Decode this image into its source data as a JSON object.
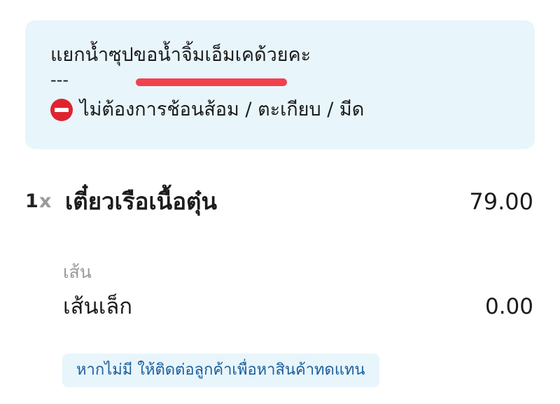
{
  "note": {
    "customer_note": "แยกน้ำซุปขอน้ำจิ้มเอ็มเคด้วยคะ",
    "separator": "---",
    "cutlery_icon": "no-entry-icon",
    "cutlery_text": "ไม่ต้องการช้อนส้อม / ตะเกียบ / มีด"
  },
  "item": {
    "quantity": "1",
    "times": "x",
    "name": "เตี๋ยวเรือเนื้อตุ๋น",
    "price": "79.00"
  },
  "option": {
    "group": "เส้น",
    "name": "เส้นเล็ก",
    "price": "0.00"
  },
  "substitute": {
    "label": "หากไม่มี ให้ติดต่อลูกค้าเพื่อหาสินค้าทดแทน"
  },
  "colors": {
    "note_background": "#e8f5fb",
    "redaction": "#f1414f",
    "no_entry": "#e0242f",
    "substitute_text": "#1b5f9e",
    "muted_text": "#9a9a9a"
  }
}
